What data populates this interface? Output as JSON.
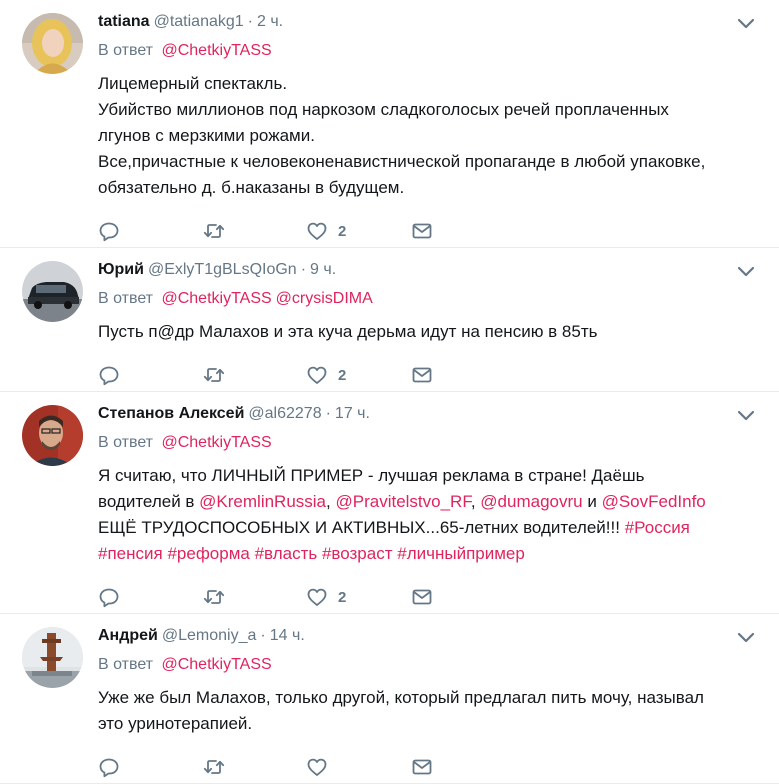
{
  "reply_prefix": "В ответ",
  "tweets": [
    {
      "name": "tatiana",
      "handle": "@tatianakg1",
      "time": "2 ч.",
      "mentions": [
        "@ChetkiyTASS"
      ],
      "lines": [
        "Лицемерный спектакль.",
        "Убийство миллионов под наркозом сладкоголосых речей проплаченных",
        "лгунов с мерзкими рожами.",
        "Все,причастные к человеконенавистнической пропаганде в любой упаковке,",
        "обязательно д. б.наказаны в будущем."
      ],
      "likes": "2"
    },
    {
      "name": "Юрий",
      "handle": "@ExlyT1gBLsQIoGn",
      "time": "9 ч.",
      "mentions": [
        "@ChetkiyTASS",
        "@crysisDIMA"
      ],
      "lines": [
        "Пусть п@др Малахов и эта куча дерьма идут на пенсию в 85ть"
      ],
      "likes": "2"
    },
    {
      "name": "Степанов Алексей",
      "handle": "@al62278",
      "time": "17 ч.",
      "mentions": [
        "@ChetkiyTASS"
      ],
      "text_parts": [
        {
          "t": "Я считаю, что ЛИЧНЫЙ ПРИМЕР - лучшая реклама в стране! Даёшь"
        },
        {
          "br": true
        },
        {
          "t": "водителей в "
        },
        {
          "link": "@KremlinRussia"
        },
        {
          "t": ", "
        },
        {
          "link": "@Pravitelstvo_RF"
        },
        {
          "t": ", "
        },
        {
          "link": "@dumagovru"
        },
        {
          "t": " и "
        },
        {
          "link": "@SovFedInfo"
        },
        {
          "br": true
        },
        {
          "t": "ЕЩЁ ТРУДОСПОСОБНЫХ И АКТИВНЫХ...65-летних водителей!!! "
        },
        {
          "link": "#Россия"
        },
        {
          "br": true
        },
        {
          "link": "#пенсия"
        },
        {
          "t": " "
        },
        {
          "link": "#реформа"
        },
        {
          "t": " "
        },
        {
          "link": "#власть"
        },
        {
          "t": " "
        },
        {
          "link": "#возраст"
        },
        {
          "t": " "
        },
        {
          "link": "#личныйпример"
        }
      ],
      "likes": "2"
    },
    {
      "name": "Андрей",
      "handle": "@Lemoniy_a",
      "time": "14 ч.",
      "mentions": [
        "@ChetkiyTASS"
      ],
      "lines": [
        "Уже же был Малахов, только другой, который предлагал пить мочу, называл",
        "это уринотерапией."
      ],
      "likes": ""
    }
  ],
  "colors": {
    "accent": "#e0245e",
    "muted": "#657786",
    "text": "#14171a",
    "divider": "#e6ecf0"
  },
  "icons": {
    "reply": "reply-icon",
    "retweet": "retweet-icon",
    "like": "heart-icon",
    "message": "envelope-icon",
    "menu": "chevron-down-icon"
  }
}
